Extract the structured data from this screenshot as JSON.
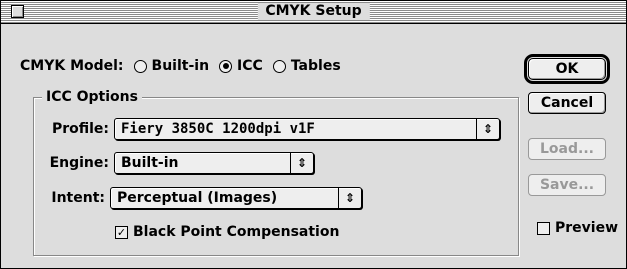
{
  "window": {
    "title": "CMYK Setup"
  },
  "cmyk_model": {
    "label": "CMYK Model:",
    "options": [
      {
        "label": "Built-in",
        "selected": false
      },
      {
        "label": "ICC",
        "selected": true
      },
      {
        "label": "Tables",
        "selected": false
      }
    ]
  },
  "icc_options": {
    "legend": "ICC Options",
    "profile": {
      "label": "Profile:",
      "value": "Fiery 3850C 1200dpi v1F"
    },
    "engine": {
      "label": "Engine:",
      "value": "Built-in"
    },
    "intent": {
      "label": "Intent:",
      "value": "Perceptual (Images)"
    },
    "black_point": {
      "label": "Black Point Compensation",
      "checked": true
    }
  },
  "buttons": {
    "ok": "OK",
    "cancel": "Cancel",
    "load": "Load...",
    "save": "Save..."
  },
  "preview": {
    "label": "Preview",
    "checked": false
  },
  "icons": {
    "popup_arrow": "updown-arrows-icon",
    "close_box": "close-box-icon"
  },
  "colors": {
    "window_bg": "#dddddd",
    "disabled_text": "#999999"
  }
}
